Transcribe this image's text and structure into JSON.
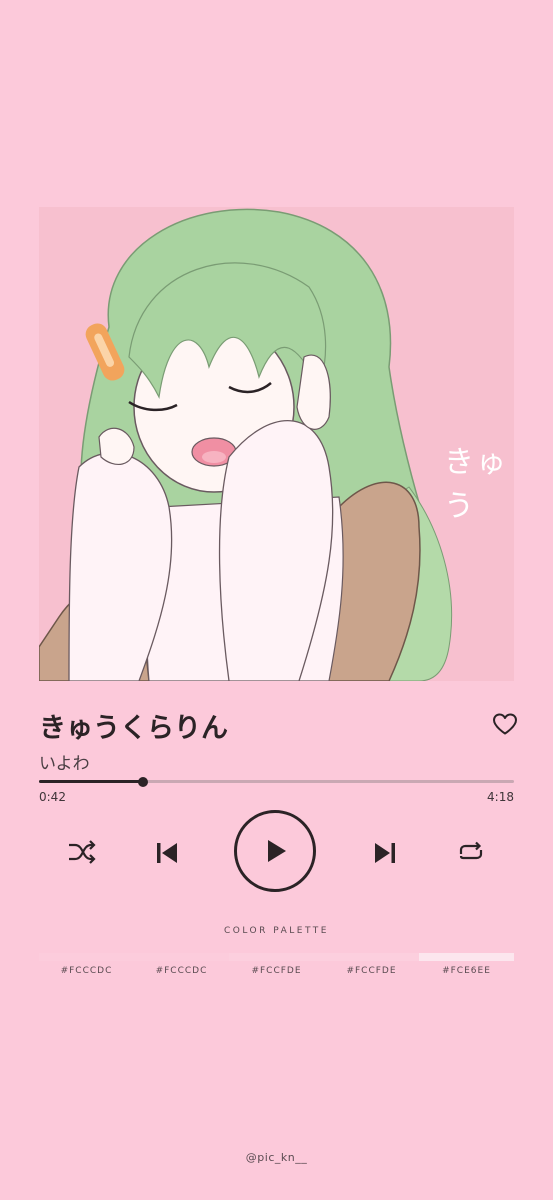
{
  "album_art": {
    "caption": "きゅう",
    "palette": {
      "background": "#F7C0CF",
      "hair": "#A9D3A0",
      "shirt": "#FFF3F7",
      "jacket": "#C9A48C",
      "clip": "#F2A45C"
    }
  },
  "track": {
    "title": "きゅうくらりん",
    "artist": "いよわ",
    "current_time": "0:42",
    "total_time": "4:18",
    "progress": 0.219
  },
  "controls": {
    "shuffle": "shuffle-icon",
    "previous": "skip-previous-icon",
    "play": "play-icon",
    "next": "skip-next-icon",
    "repeat": "repeat-icon",
    "like": "heart-icon"
  },
  "palette": {
    "title": "COLOR PALETTE",
    "swatches": [
      {
        "label": "#FCCCDC",
        "color": "#FCCCDC"
      },
      {
        "label": "#FCCCDC",
        "color": "#FCCCDC"
      },
      {
        "label": "#FCCFDE",
        "color": "#FCCFDE"
      },
      {
        "label": "#FCCFDE",
        "color": "#FCCFDE"
      },
      {
        "label": "#FCE6EE",
        "color": "#FCE6EE"
      }
    ]
  },
  "credit": "@pic_kn__",
  "colors": {
    "background": "#FCC9DA",
    "accent": "#2B2326"
  }
}
